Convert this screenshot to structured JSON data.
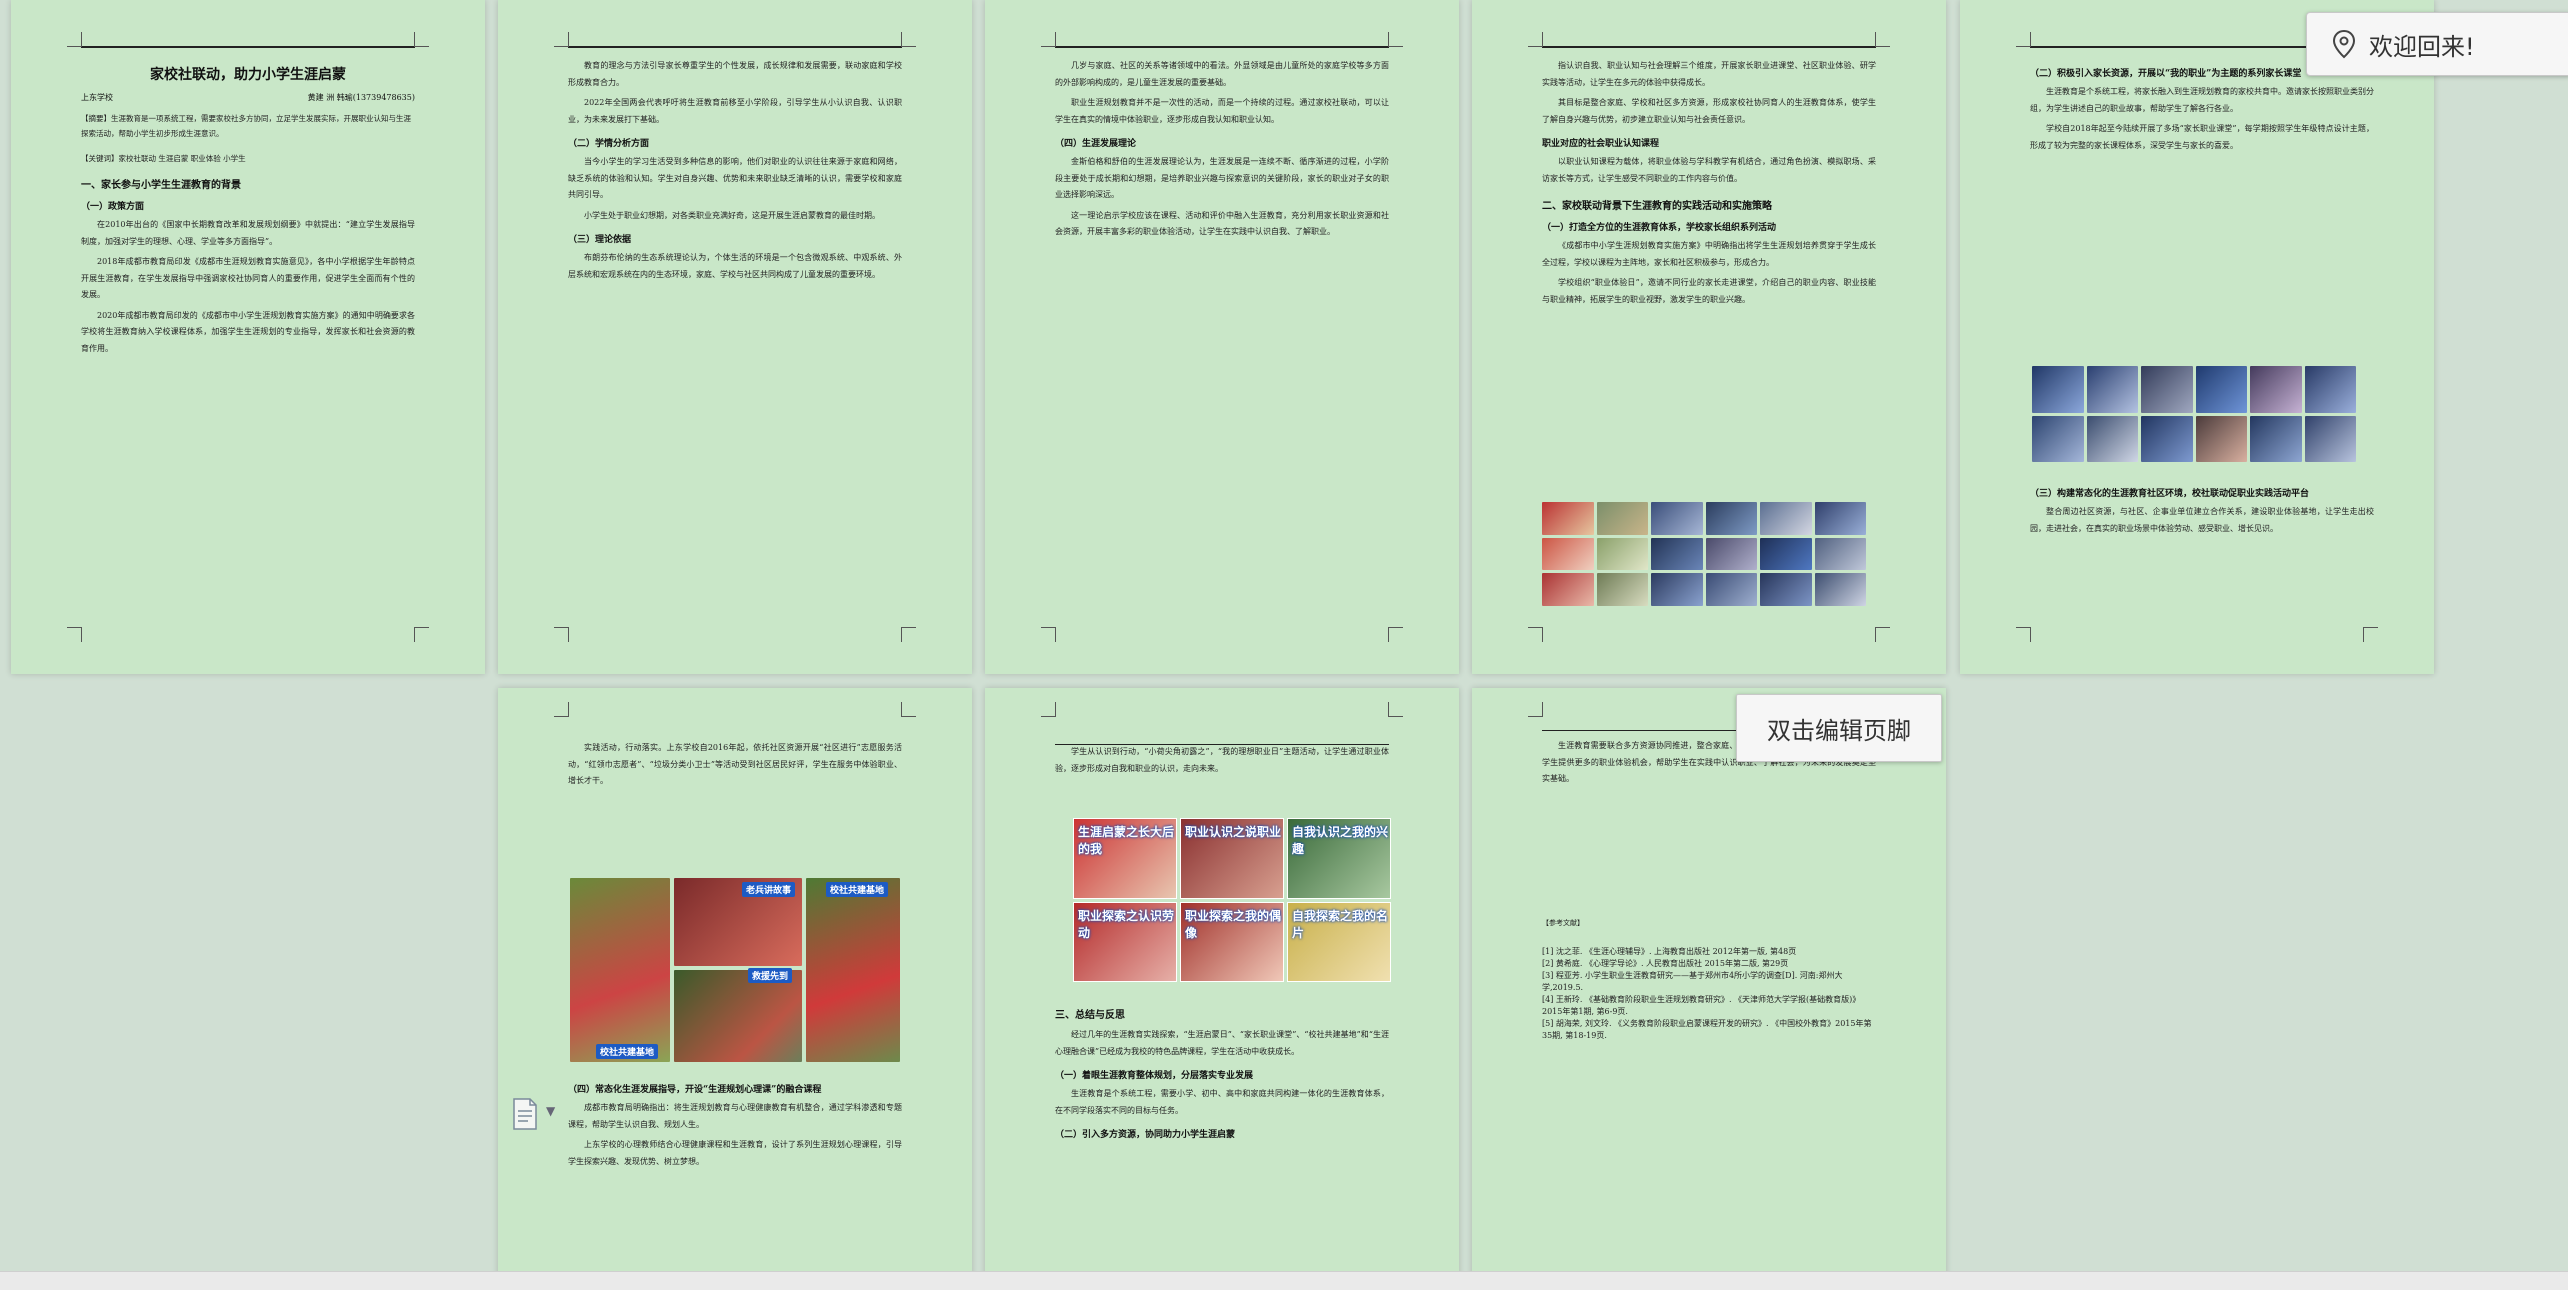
{
  "document": {
    "title": "家校社联动，助力小学生涯启蒙",
    "school": "上东学校",
    "authors": "黄建 洲 韩瑜(13739478635)",
    "abstract": "【摘要】生涯教育是一项系统工程，需要家校社多方协同，立足学生发展实际，开展职业认知与生涯探索活动，帮助小学生初步形成生涯意识。",
    "abstract2": "【关键词】家校社联动 生涯启蒙 职业体验 小学生",
    "section1": "一、家长参与小学生生涯教育的背景",
    "sub_policy": "（一）政策方面",
    "p1_1": "在2010年出台的《国家中长期教育改革和发展规划纲要》中就提出：“建立学生发展指导制度，加强对学生的理想、心理、学业等多方面指导”。",
    "p1_2": "2018年成都市教育局印发《成都市生涯规划教育实施意见》，各中小学根据学生年龄特点开展生涯教育，在学生发展指导中强调家校社协同育人的重要作用，促进学生全面而有个性的发展。",
    "p1_3": "2020年成都市教育局印发的《成都市中小学生涯规划教育实施方案》的通知中明确要求各学校将生涯教育纳入学校课程体系，加强学生生涯规划的专业指导，发挥家长和社会资源的教育作用。",
    "p2_1": "教育的理念与方法引导家长尊重学生的个性发展，成长规律和发展需要，联动家庭和学校形成教育合力。",
    "p2_2": "2022年全国两会代表呼吁将生涯教育前移至小学阶段，引导学生从小认识自我、认识职业，为未来发展打下基础。",
    "sub_psych": "（二）学情分析方面",
    "p2_3": "当今小学生的学习生活受到多种信息的影响，他们对职业的认识往往来源于家庭和网络，缺乏系统的体验和认知。学生对自身兴趣、优势和未来职业缺乏清晰的认识，需要学校和家庭共同引导。",
    "p2_4": "小学生处于职业幻想期，对各类职业充满好奇，这是开展生涯启蒙教育的最佳时期。",
    "sub_theory": "（三）理论依据",
    "p2_5": "布朗芬布伦纳的生态系统理论认为，个体生活的环境是一个包含微观系统、中观系统、外层系统和宏观系统在内的生态环境，家庭、学校与社区共同构成了儿童发展的重要环境。",
    "p3_1": "几岁与家庭、社区的关系等诸领域中的看法。外显领域是由儿童所处的家庭学校等多方面的外部影响构成的，是儿童生涯发展的重要基础。",
    "p3_2": "职业生涯规划教育并不是一次性的活动，而是一个持续的过程。通过家校社联动，可以让学生在真实的情境中体验职业，逐步形成自我认知和职业认知。",
    "sub_growth": "（四）生涯发展理论",
    "p3_3": "金斯伯格和舒伯的生涯发展理论认为，生涯发展是一连续不断、循序渐进的过程，小学阶段主要处于成长期和幻想期，是培养职业兴趣与探索意识的关键阶段，家长的职业对子女的职业选择影响深远。",
    "p3_4": "这一理论启示学校应该在课程、活动和评价中融入生涯教育，充分利用家长职业资源和社会资源，开展丰富多彩的职业体验活动，让学生在实践中认识自我、了解职业。",
    "p4_1": "指认识自我、职业认知与社会理解三个维度，开展家长职业进课堂、社区职业体验、研学实践等活动，让学生在多元的体验中获得成长。",
    "p4_2": "其目标是整合家庭、学校和社区多方资源，形成家校社协同育人的生涯教育体系，使学生了解自身兴趣与优势，初步建立职业认知与社会责任意识。",
    "sub_values": "职业对应的社会职业认知课程",
    "p4_3": "以职业认知课程为载体，将职业体验与学科教学有机结合，通过角色扮演、模拟职场、采访家长等方式，让学生感受不同职业的工作内容与价值。",
    "sec2": "二、家校联动背景下生涯教育的实践活动和实施策略",
    "sub_plan": "（一）打造全方位的生涯教育体系，学校家长组织系列活动",
    "p4_4": "《成都市中小学生涯规划教育实施方案》中明确指出将学生生涯规划培养贯穿于学生成长全过程，学校以课程为主阵地，家长和社区积极参与，形成合力。",
    "p4_5": "学校组织“职业体验日”，邀请不同行业的家长走进课堂，介绍自己的职业内容、职业技能与职业精神，拓展学生的职业视野，激发学生的职业兴趣。",
    "sub_p5_1": "（二）积极引入家长资源，开展以“我的职业”为主题的系列家长课堂",
    "p5_1": "生涯教育是个系统工程，将家长融入到生涯规划教育的家校共育中。邀请家长按照职业类别分组，为学生讲述自己的职业故事，帮助学生了解各行各业。",
    "p5_2": "学校自2018年起至今陆续开展了多场“家长职业课堂”，每学期按照学生年级特点设计主题，形成了较为完整的家长课程体系，深受学生与家长的喜爱。",
    "sub_p5_2": "（三）构建常态化的生涯教育社区环境，校社联动促职业实践活动平台",
    "p5_3": "整合周边社区资源，与社区、企事业单位建立合作关系，建设职业体验基地，让学生走出校园，走进社会，在真实的职业场景中体验劳动、感受职业、增长见识。",
    "p6_1": "实践活动，行动落实。上东学校自2016年起，依托社区资源开展“社区进行”志愿服务活动，“红领巾志愿者”、“垃圾分类小卫士”等活动受到社区居民好评，学生在服务中体验职业、增长才干。",
    "sub_p6": "（四）常态化生涯发展指导，开设“生涯规划心理课”的融合课程",
    "p6_2": "成都市教育局明确指出：将生涯规划教育与心理健康教育有机整合，通过学科渗透和专题课程，帮助学生认识自我、规划人生。",
    "p6_3": "上东学校的心理教师结合心理健康课程和生涯教育，设计了系列生涯规划心理课程，引导学生探索兴趣、发现优势、树立梦想。",
    "p7_1": "学生从认识到行动，“小荷尖角初露之”，“我的理想职业日”主题活动，让学生通过职业体验，逐步形成对自我和职业的认识，走向未来。",
    "sec3": "三、总结与反思",
    "p7_2": "经过几年的生涯教育实践探索，“生涯启蒙日”、“家长职业课堂”、“校社共建基地”和“生涯心理融合课”已经成为我校的特色品牌课程，学生在活动中收获成长。",
    "sub_p7_1": "（一）着眼生涯教育整体规划，分层落实专业发展",
    "p7_3": "生涯教育是个系统工程，需要小学、初中、高中和家庭共同构建一体化的生涯教育体系，在不同学段落实不同的目标与任务。",
    "sub_p7_2": "（二）引入多方资源，协同助力小学生涯启蒙",
    "p8_1": "生涯教育需要联合多方资源协同推进，整合家庭、学校和社区的力量，形成教育合力，为学生提供更多的职业体验机会，帮助学生在实践中认识职业、了解社会，为未来的发展奠定坚实基础。",
    "refs_title": "【参考文献】",
    "refs": [
      "[1] 沈之菲. 《生涯心理辅导》. 上海教育出版社 2012年第一版, 第48页",
      "[2] 黄希庭. 《心理学导论》. 人民教育出版社 2015年第二版, 第29页",
      "[3] 程亚芳. 小学生职业生涯教育研究——基于郑州市4所小学的调查[D]. 河南:郑州大学,2019.5.",
      "[4] 王新玲. 《基础教育阶段职业生涯规划教育研究》. 《天津师范大学学报(基础教育版)》2015年第1期, 第6-9页.",
      "[5] 胡海荣, 刘文玲. 《义务教育阶段职业启蒙课程开发的研究》. 《中国校外教育》2015年第35期, 第18-19页."
    ]
  },
  "photo_captions": {
    "c1": "老兵讲故事",
    "c2": "校社共建基地",
    "c3": "救援先到",
    "c4": "校社共建基地",
    "t1": "生涯启蒙之长大后的我",
    "t2": "职业认识之说职业",
    "t3": "自我认识之我的兴趣",
    "t4": "职业探索之认识劳动",
    "t5": "职业探索之我的偶像",
    "t6": "自我探索之我的名片"
  },
  "overlays": {
    "welcome": "欢迎回来!",
    "header_hint": "双击编辑页脚"
  },
  "icons": {
    "welcome": "location-pin-icon",
    "side": "document-icon"
  },
  "colors": {
    "page_bg": "#c9e7c8",
    "workspace": "#d0dfd3"
  }
}
